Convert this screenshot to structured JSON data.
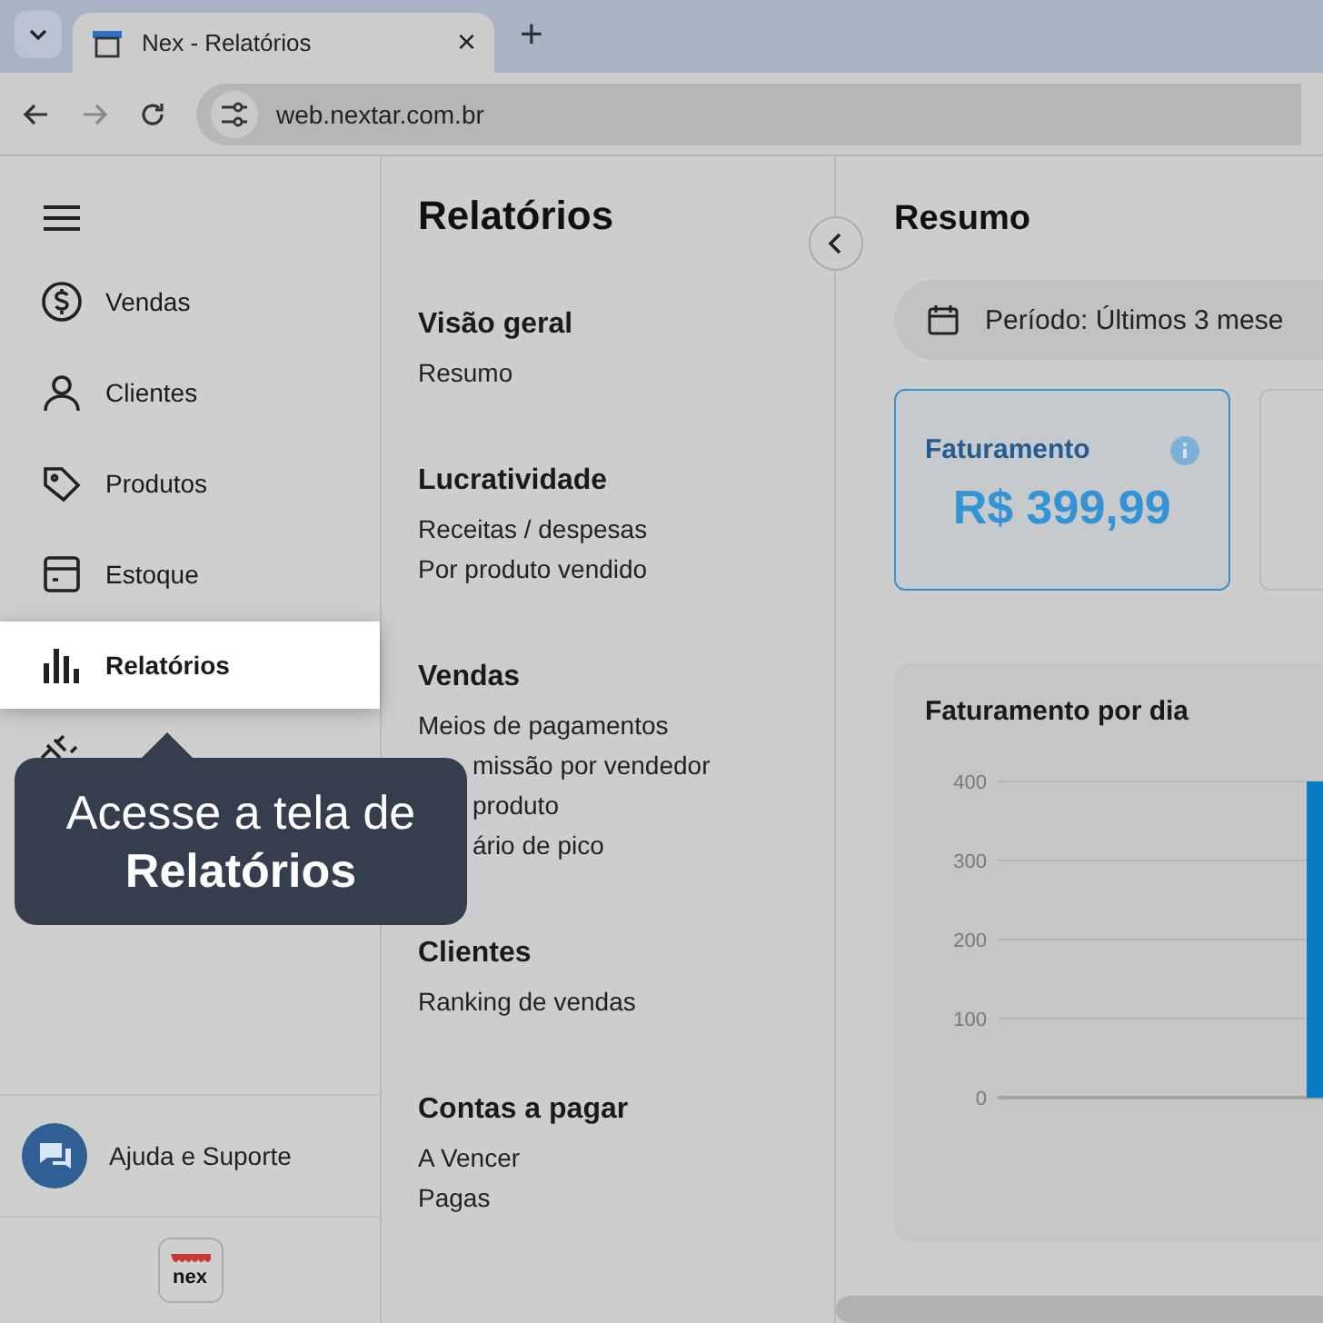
{
  "browser": {
    "tabs": [
      {
        "title": "Nex - Relatórios",
        "selected": true
      }
    ],
    "close_tab": "×",
    "new_tab": "+",
    "address": "web.nextar.com.br"
  },
  "sidebar": {
    "items": [
      {
        "label": "Vendas",
        "kind": "dollar",
        "selected": false
      },
      {
        "label": "Clientes",
        "kind": "person",
        "selected": false
      },
      {
        "label": "Produtos",
        "kind": "tag",
        "selected": false
      },
      {
        "label": "Estoque",
        "kind": "box",
        "selected": false
      },
      {
        "label": "Relatórios",
        "kind": "chart",
        "selected": true
      },
      {
        "kind": "plug",
        "selected": false
      }
    ],
    "help": "Ajuda e Suporte",
    "logo": "nex"
  },
  "tooltip": "Acesse a tela de **Relatórios**",
  "reports": {
    "title": "Relatórios",
    "sections": [
      {
        "heading": "Visão geral",
        "links": [
          "Resumo"
        ]
      },
      {
        "heading": "Lucratividade",
        "links": [
          "Receitas / despesas",
          "Por produto vendido"
        ]
      },
      {
        "heading": "Vendas",
        "links": [
          "Meios de pagamentos",
          "missão por vendedor",
          "produto",
          "ário de pico"
        ],
        "covered_links": [
          false,
          true,
          true,
          true
        ]
      },
      {
        "heading": "Clientes",
        "links": [
          "Ranking de vendas"
        ]
      },
      {
        "heading": "Contas a pagar",
        "links": [
          "A Vencer",
          "Pagas"
        ]
      }
    ]
  },
  "summary": {
    "title": "Resumo",
    "period": "Período: Últimos 3 mese",
    "cards": [
      {
        "label": "Faturamento",
        "value": "R$ 399,99",
        "selected": true
      }
    ],
    "chart_data": {
      "type": "bar",
      "grid": true,
      "title": "Faturamento por dia",
      "ylim": [
        0,
        400
      ],
      "yticks": [
        0,
        100,
        200,
        300,
        400
      ],
      "values": [
        400
      ]
    }
  }
}
